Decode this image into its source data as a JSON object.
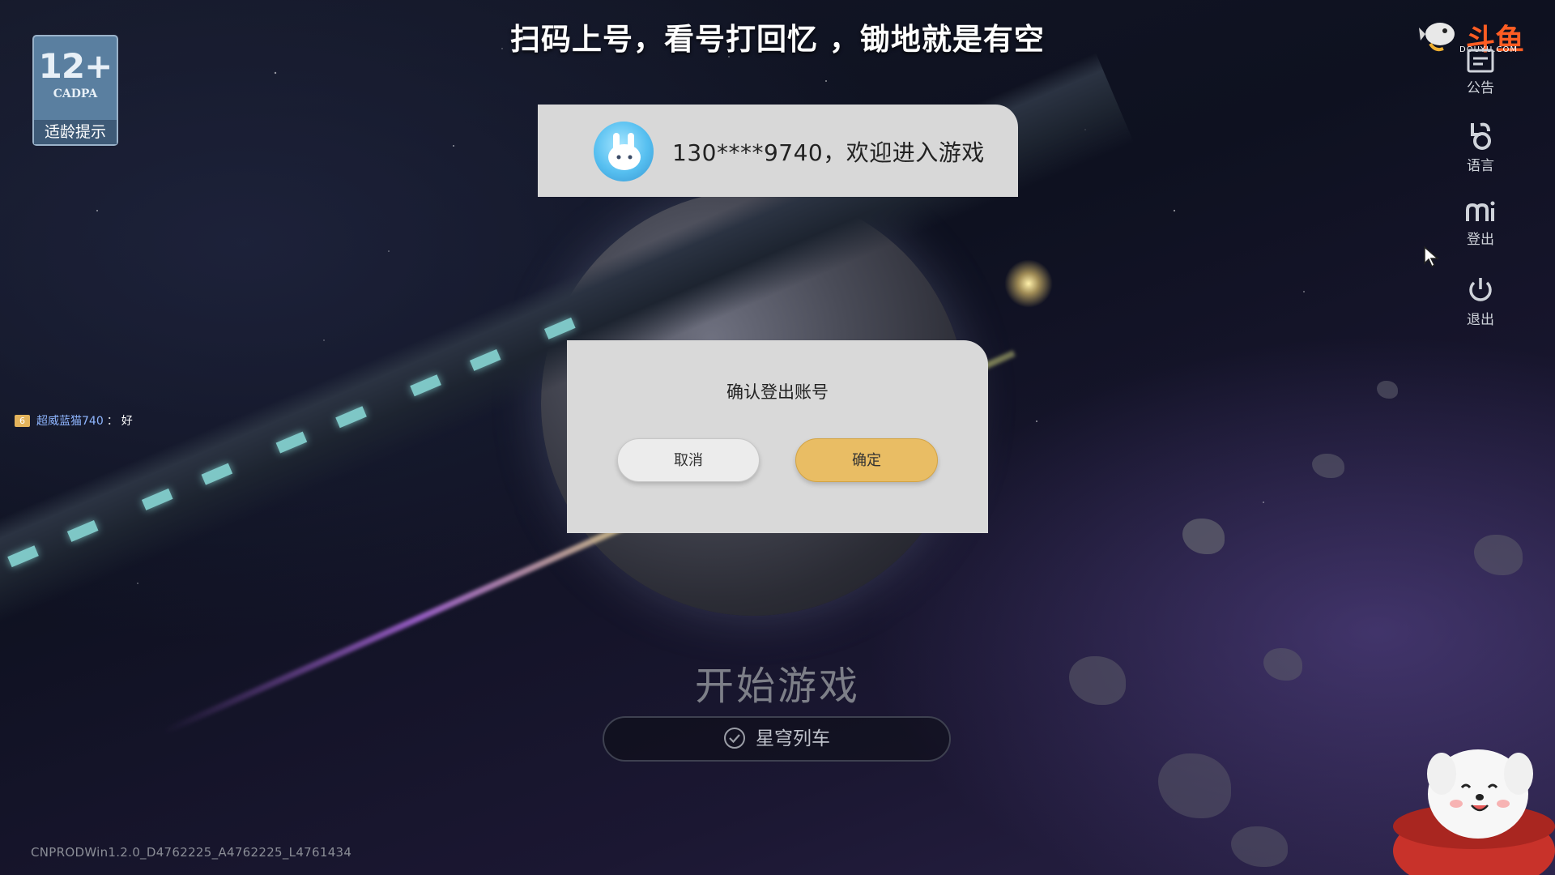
{
  "banner": {
    "text": "扫码上号，看号打回忆 ，锄地就是有空"
  },
  "age_rating": {
    "number": "12+",
    "org": "CADPA",
    "tip": "适龄提示"
  },
  "douyu": {
    "brand": "斗鱼",
    "domain": "DOUYU.COM"
  },
  "side_menu": [
    {
      "icon": "notice-icon",
      "label": "公告"
    },
    {
      "icon": "language-icon",
      "label": "语言"
    },
    {
      "icon": "mi-logout-icon",
      "label": "登出"
    },
    {
      "icon": "power-icon",
      "label": "退出"
    }
  ],
  "welcome": {
    "text": "130****9740，欢迎进入游戏"
  },
  "dialog": {
    "title": "确认登出账号",
    "cancel_label": "取消",
    "ok_label": "确定"
  },
  "start": {
    "label": "开始游戏"
  },
  "server": {
    "name": "星穹列车"
  },
  "chat": {
    "badge": "6",
    "user": "超威蓝猫740",
    "separator": "：",
    "message": "好"
  },
  "version": {
    "text": "CNPRODWin1.2.0_D4762225_A4762225_L4761434"
  },
  "colors": {
    "dialog_bg": "#d9d9d9",
    "ok_button": "#e9bd64",
    "douyu_brand": "#ff5d23"
  }
}
